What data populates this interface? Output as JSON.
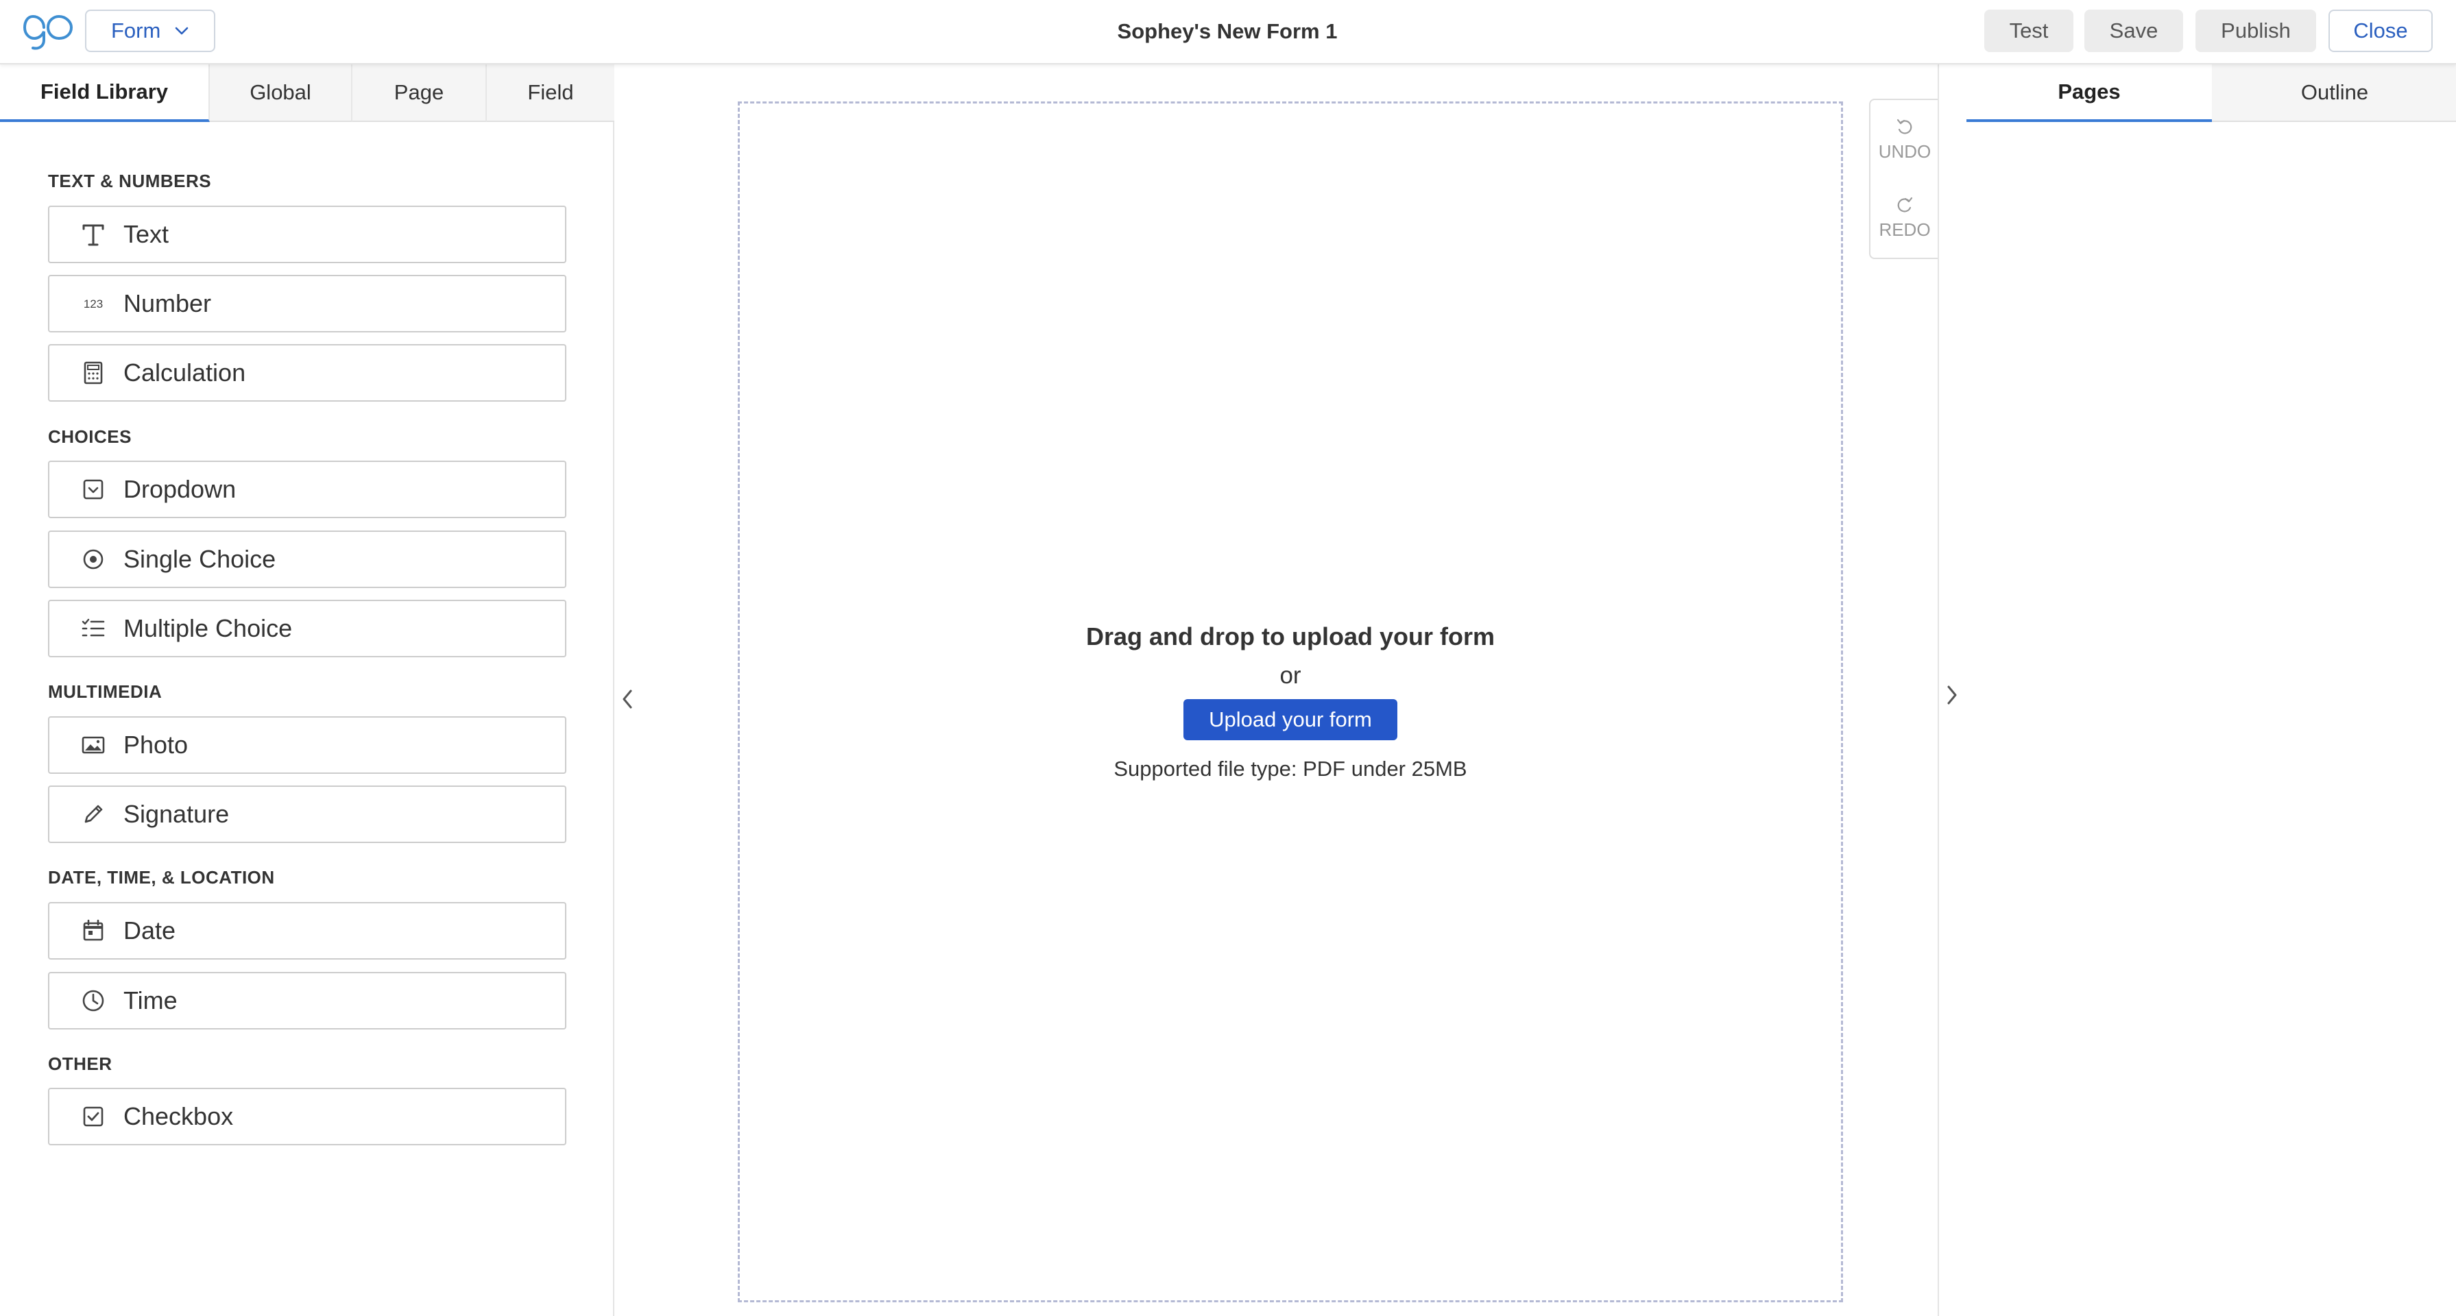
{
  "header": {
    "logo_icon": "forms-logo-icon",
    "mode_select": "Form",
    "title": "Sophey's New Form 1",
    "buttons": {
      "test": "Test",
      "save": "Save",
      "publish": "Publish",
      "close": "Close"
    }
  },
  "left_panel": {
    "tabs": [
      "Field Library",
      "Global",
      "Page",
      "Field"
    ],
    "sections": [
      {
        "label": "TEXT & NUMBERS",
        "items": [
          {
            "label": "Text",
            "icon": "text-icon"
          },
          {
            "label": "Number",
            "icon": "number-icon"
          },
          {
            "label": "Calculation",
            "icon": "calculator-icon"
          }
        ]
      },
      {
        "label": "CHOICES",
        "items": [
          {
            "label": "Dropdown",
            "icon": "dropdown-icon"
          },
          {
            "label": "Single Choice",
            "icon": "radio-icon"
          },
          {
            "label": "Multiple Choice",
            "icon": "checklist-icon"
          }
        ]
      },
      {
        "label": "MULTIMEDIA",
        "items": [
          {
            "label": "Photo",
            "icon": "photo-icon"
          },
          {
            "label": "Signature",
            "icon": "pen-icon"
          }
        ]
      },
      {
        "label": "DATE, TIME, & LOCATION",
        "items": [
          {
            "label": "Date",
            "icon": "calendar-icon"
          },
          {
            "label": "Time",
            "icon": "clock-icon"
          }
        ]
      },
      {
        "label": "OTHER",
        "items": [
          {
            "label": "Checkbox",
            "icon": "checkbox-icon"
          }
        ]
      }
    ]
  },
  "canvas": {
    "drop_title": "Drag and drop to upload your form",
    "or_text": "or",
    "upload_button": "Upload your form",
    "supported_note": "Supported file type: PDF under 25MB",
    "undo_label": "UNDO",
    "redo_label": "REDO"
  },
  "right_panel": {
    "tabs": [
      "Pages",
      "Outline"
    ]
  },
  "colors": {
    "accent": "#2557c9",
    "tab_underline": "#3a7bd5",
    "link": "#2a5fbf"
  }
}
